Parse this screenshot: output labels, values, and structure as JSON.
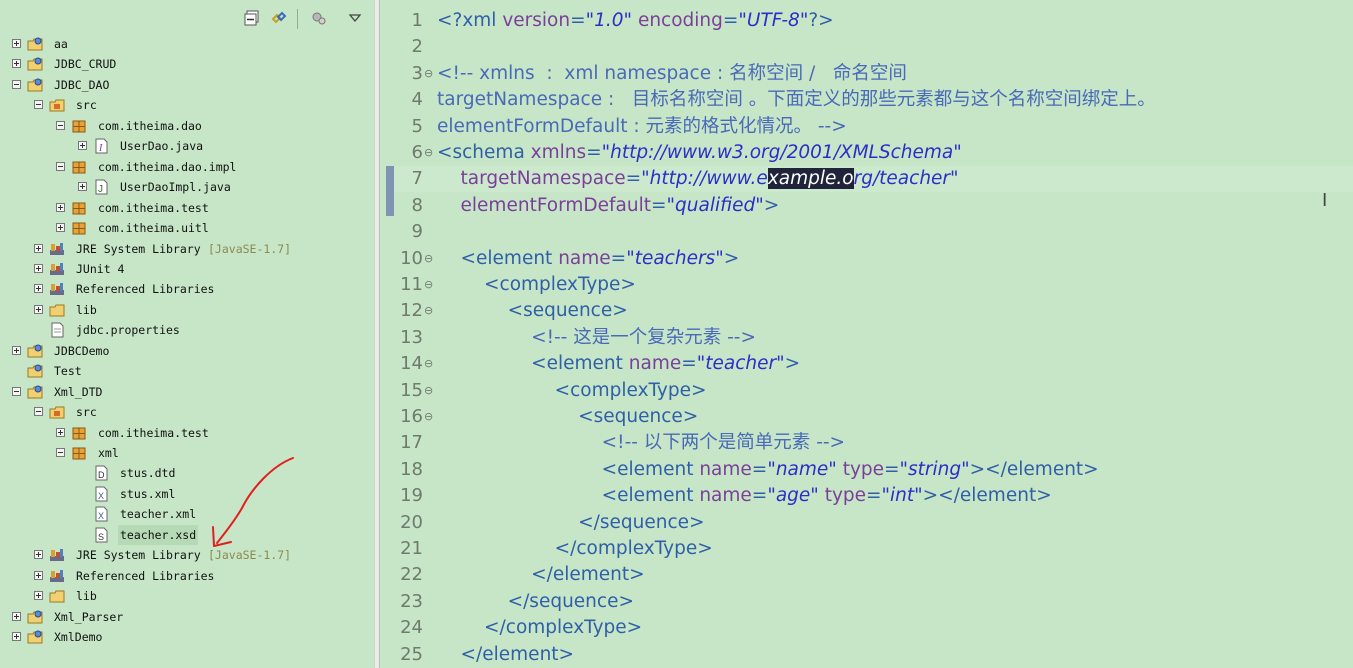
{
  "explorer": {
    "toolbar": [
      "collapse-all-icon",
      "link-with-editor-icon",
      "view-menu-icon",
      "chevron-down-icon"
    ],
    "items": [
      {
        "label": "aa",
        "icon": "project-icon"
      },
      {
        "label": "JDBC_CRUD",
        "icon": "project-icon"
      },
      {
        "label": "JDBC_DAO",
        "icon": "project-icon"
      },
      {
        "label": "src",
        "icon": "source-folder-icon"
      },
      {
        "label": "com.itheima.dao",
        "icon": "package-icon"
      },
      {
        "label": "UserDao.java",
        "icon": "java-interface-icon"
      },
      {
        "label": "com.itheima.dao.impl",
        "icon": "package-icon"
      },
      {
        "label": "UserDaoImpl.java",
        "icon": "java-class-icon"
      },
      {
        "label": "com.itheima.test",
        "icon": "package-icon"
      },
      {
        "label": "com.itheima.uitl",
        "icon": "package-icon"
      },
      {
        "label": "JRE System Library",
        "suffix": "[JavaSE-1.7]",
        "icon": "library-icon"
      },
      {
        "label": "JUnit 4",
        "icon": "library-icon"
      },
      {
        "label": "Referenced Libraries",
        "icon": "library-icon"
      },
      {
        "label": "lib",
        "icon": "folder-icon"
      },
      {
        "label": "jdbc.properties",
        "icon": "file-icon"
      },
      {
        "label": "JDBCDemo",
        "icon": "project-icon"
      },
      {
        "label": "Test",
        "icon": "project-icon"
      },
      {
        "label": "Xml_DTD",
        "icon": "project-icon"
      },
      {
        "label": "src",
        "icon": "source-folder-icon"
      },
      {
        "label": "com.itheima.test",
        "icon": "package-icon"
      },
      {
        "label": "xml",
        "icon": "package-icon"
      },
      {
        "label": "stus.dtd",
        "icon": "dtd-file-icon"
      },
      {
        "label": "stus.xml",
        "icon": "xml-file-icon"
      },
      {
        "label": "teacher.xml",
        "icon": "xml-file-icon"
      },
      {
        "label": "teacher.xsd",
        "icon": "xsd-file-icon"
      },
      {
        "label": "JRE System Library",
        "suffix": "[JavaSE-1.7]",
        "icon": "library-icon"
      },
      {
        "label": "Referenced Libraries",
        "icon": "library-icon"
      },
      {
        "label": "lib",
        "icon": "folder-icon"
      },
      {
        "label": "Xml_Parser",
        "icon": "project-icon"
      },
      {
        "label": "XmlDemo",
        "icon": "project-icon"
      }
    ]
  },
  "editor": {
    "lines": [
      {
        "n": "1",
        "segs": [
          [
            "tag",
            "<?xml "
          ],
          [
            "attr",
            "version"
          ],
          [
            "tag",
            "="
          ],
          [
            "val",
            "\"1.0\""
          ],
          [
            "tag",
            " "
          ],
          [
            "attr",
            "encoding"
          ],
          [
            "tag",
            "="
          ],
          [
            "val",
            "\"UTF-8\""
          ],
          [
            "tag",
            "?>"
          ]
        ]
      },
      {
        "n": "2",
        "segs": []
      },
      {
        "n": "3",
        "fold": true,
        "segs": [
          [
            "cmt",
            "<!-- xmlns  :  xml namespace : 名称空间 /   命名空间"
          ]
        ]
      },
      {
        "n": "4",
        "segs": [
          [
            "cmt",
            "targetNamespace :   目标名称空间 。下面定义的那些元素都与这个名称空间绑定上。"
          ]
        ]
      },
      {
        "n": "5",
        "segs": [
          [
            "cmt",
            "elementFormDefault : 元素的格式化情况。 -->"
          ]
        ]
      },
      {
        "n": "6",
        "fold": true,
        "segs": [
          [
            "tag",
            "<schema "
          ],
          [
            "attr",
            "xmlns"
          ],
          [
            "tag",
            "="
          ],
          [
            "val",
            "\"http://www.w3.org/2001/XMLSchema\""
          ]
        ]
      },
      {
        "n": "7",
        "segs": [
          [
            "tag",
            "    "
          ],
          [
            "attr",
            "targetNamespace"
          ],
          [
            "tag",
            "="
          ],
          [
            "val",
            "\"http://www.e"
          ],
          [
            "val hl",
            "xample.o"
          ],
          [
            "val",
            "rg/teacher\""
          ]
        ]
      },
      {
        "n": "8",
        "segs": [
          [
            "tag",
            "    "
          ],
          [
            "attr",
            "elementFormDefault"
          ],
          [
            "tag",
            "="
          ],
          [
            "val",
            "\"qualified\""
          ],
          [
            "tag",
            ">"
          ]
        ]
      },
      {
        "n": "9",
        "segs": []
      },
      {
        "n": "10",
        "fold": true,
        "segs": [
          [
            "tag",
            "    <element "
          ],
          [
            "attr",
            "name"
          ],
          [
            "tag",
            "="
          ],
          [
            "val",
            "\"teachers\""
          ],
          [
            "tag",
            ">"
          ]
        ]
      },
      {
        "n": "11",
        "fold": true,
        "segs": [
          [
            "tag",
            "        <complexType>"
          ]
        ]
      },
      {
        "n": "12",
        "fold": true,
        "segs": [
          [
            "tag",
            "            <sequence>"
          ]
        ]
      },
      {
        "n": "13",
        "segs": [
          [
            "cmt",
            "                <!-- 这是一个复杂元素 -->"
          ]
        ]
      },
      {
        "n": "14",
        "fold": true,
        "segs": [
          [
            "tag",
            "                <element "
          ],
          [
            "attr",
            "name"
          ],
          [
            "tag",
            "="
          ],
          [
            "val",
            "\"teacher\""
          ],
          [
            "tag",
            ">"
          ]
        ]
      },
      {
        "n": "15",
        "fold": true,
        "segs": [
          [
            "tag",
            "                    <complexType>"
          ]
        ]
      },
      {
        "n": "16",
        "fold": true,
        "segs": [
          [
            "tag",
            "                        <sequence>"
          ]
        ]
      },
      {
        "n": "17",
        "segs": [
          [
            "cmt",
            "                            <!-- 以下两个是简单元素 -->"
          ]
        ]
      },
      {
        "n": "18",
        "segs": [
          [
            "tag",
            "                            <element "
          ],
          [
            "attr",
            "name"
          ],
          [
            "tag",
            "="
          ],
          [
            "val",
            "\"name\""
          ],
          [
            "tag",
            " "
          ],
          [
            "attr",
            "type"
          ],
          [
            "tag",
            "="
          ],
          [
            "val",
            "\"string\""
          ],
          [
            "tag",
            "></element>"
          ]
        ]
      },
      {
        "n": "19",
        "segs": [
          [
            "tag",
            "                            <element "
          ],
          [
            "attr",
            "name"
          ],
          [
            "tag",
            "="
          ],
          [
            "val",
            "\"age\""
          ],
          [
            "tag",
            " "
          ],
          [
            "attr",
            "type"
          ],
          [
            "tag",
            "="
          ],
          [
            "val",
            "\"int\""
          ],
          [
            "tag",
            "></element>"
          ]
        ]
      },
      {
        "n": "20",
        "segs": [
          [
            "tag",
            "                        </sequence>"
          ]
        ]
      },
      {
        "n": "21",
        "segs": [
          [
            "tag",
            "                    </complexType>"
          ]
        ]
      },
      {
        "n": "22",
        "segs": [
          [
            "tag",
            "                </element>"
          ]
        ]
      },
      {
        "n": "23",
        "segs": [
          [
            "tag",
            "            </sequence>"
          ]
        ]
      },
      {
        "n": "24",
        "segs": [
          [
            "tag",
            "        </complexType>"
          ]
        ]
      },
      {
        "n": "25",
        "segs": [
          [
            "tag",
            "    </element>"
          ]
        ]
      }
    ]
  },
  "colors": {
    "background": "#c7e6c7",
    "tag": "#2f5fa8",
    "attribute": "#7a3f9a",
    "value": "#2a2fc8",
    "selection": "#20233a",
    "annotation": "#e02020"
  }
}
